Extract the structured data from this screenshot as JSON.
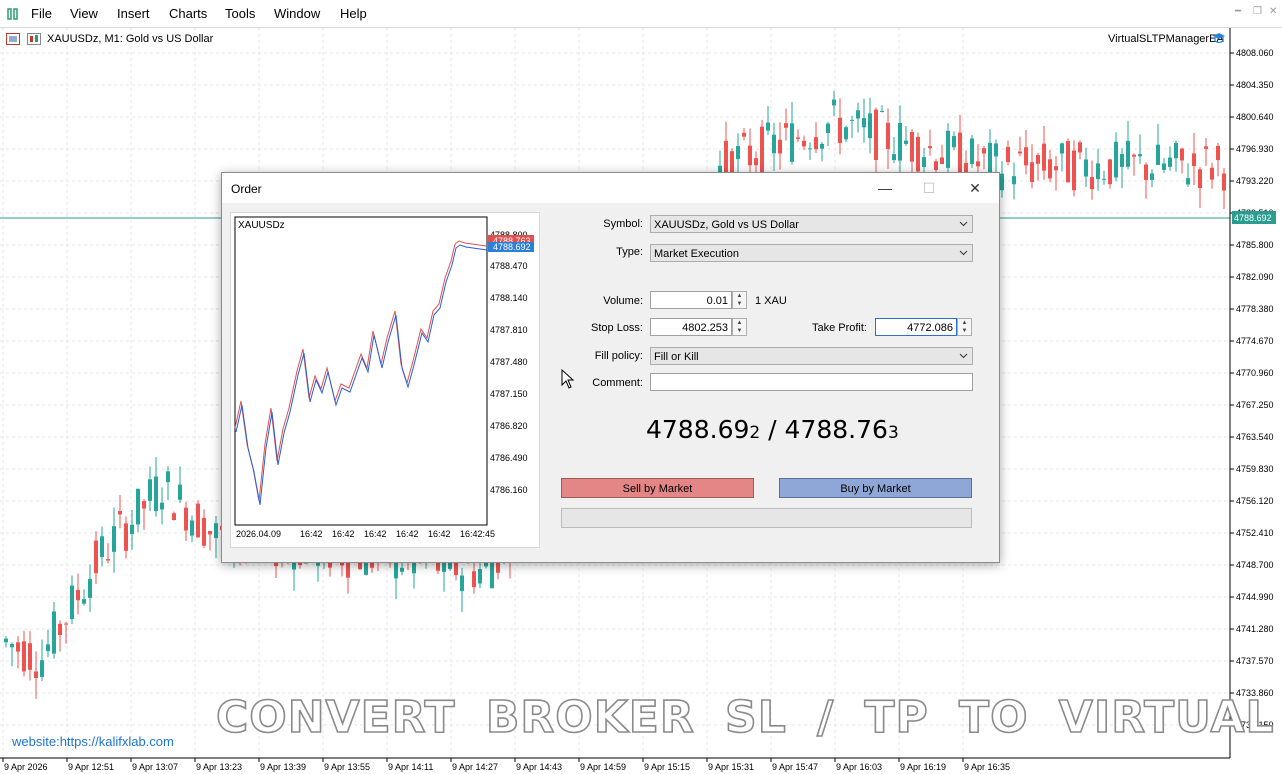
{
  "menu": {
    "items": [
      "File",
      "View",
      "Insert",
      "Charts",
      "Tools",
      "Window",
      "Help"
    ]
  },
  "chart": {
    "title": "XAUUSDz, M1:  Gold vs US Dollar",
    "ea_name": "VirtualSLTPManagerEA",
    "current_price_tag": "4788.692",
    "price_axis": [
      "4808.060",
      "4804.350",
      "4800.640",
      "4796.930",
      "4793.220",
      "4789.510",
      "4785.800",
      "4782.090",
      "4778.380",
      "4774.670",
      "4770.960",
      "4767.250",
      "4763.540",
      "4759.830",
      "4756.120",
      "4752.410",
      "4748.700",
      "4744.990",
      "4741.280",
      "4737.570",
      "4733.860",
      "4730.150"
    ],
    "time_axis": [
      "9 Apr 2026",
      "9 Apr 12:51",
      "9 Apr 13:07",
      "9 Apr 13:23",
      "9 Apr 13:39",
      "9 Apr 13:55",
      "9 Apr 14:11",
      "9 Apr 14:27",
      "9 Apr 14:43",
      "9 Apr 14:59",
      "9 Apr 15:15",
      "9 Apr 15:31",
      "9 Apr 15:47",
      "9 Apr 16:03",
      "9 Apr 16:19",
      "9 Apr 16:35"
    ],
    "colors": {
      "bull": "#26a69a",
      "bear": "#ef5350",
      "grid": "#e6e6e6",
      "price_line": "#2a9d8f"
    }
  },
  "watermark": "CONVERT  BROKER  SL / TP TO VIRTUAL",
  "website": "website:https://kalifxlab.com",
  "dialog": {
    "title": "Order",
    "controls": {
      "minimize": "—",
      "maximize": "☐",
      "close": "✕"
    },
    "mini_chart": {
      "symbol": "XAUUSDz",
      "ask_tag": "4788.763",
      "bid_tag": "4788.692",
      "axis_top_partial": "4788.800",
      "price_axis": [
        "4788.470",
        "4788.140",
        "4787.810",
        "4787.480",
        "4787.150",
        "4786.820",
        "4786.490",
        "4786.160"
      ],
      "time_axis": [
        "2026.04.09",
        "16:42",
        "16:42",
        "16:42",
        "16:42",
        "16:42",
        "16:42:45"
      ]
    },
    "form": {
      "symbol_label": "Symbol:",
      "symbol_value": "XAUUSDz, Gold vs US Dollar",
      "type_label": "Type:",
      "type_value": "Market Execution",
      "volume_label": "Volume:",
      "volume_value": "0.01",
      "volume_unit": "1 XAU",
      "sl_label": "Stop Loss:",
      "sl_value": "4802.253",
      "tp_label": "Take Profit:",
      "tp_value": "4772.086",
      "fill_label": "Fill policy:",
      "fill_value": "Fill or Kill",
      "comment_label": "Comment:",
      "comment_value": ""
    },
    "quote": {
      "bid_main": "4788.69",
      "bid_last": "2",
      "separator": " / ",
      "ask_main": "4788.76",
      "ask_last": "3"
    },
    "sell_label": "Sell by Market",
    "buy_label": "Buy by Market"
  }
}
